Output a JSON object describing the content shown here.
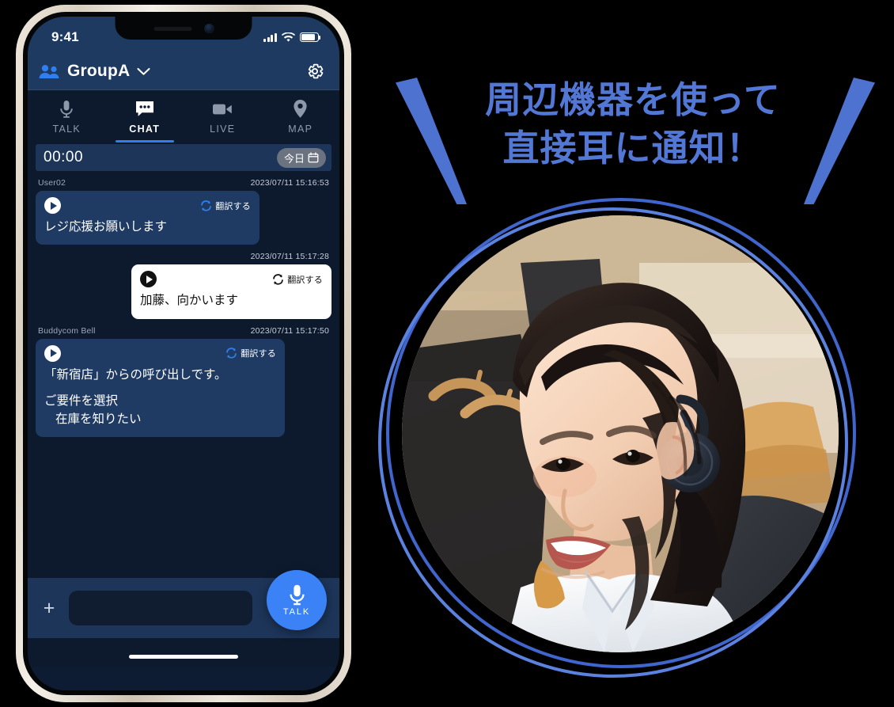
{
  "phone": {
    "status_bar": {
      "time": "9:41",
      "signal_icon": "signal-bars-icon",
      "wifi_icon": "wifi-icon",
      "battery_icon": "battery-icon"
    },
    "header": {
      "group_icon": "people-icon",
      "group_name": "GroupA",
      "chevron_icon": "chevron-down-icon",
      "settings_icon": "gear-icon"
    },
    "tabs": [
      {
        "label": "TALK",
        "icon": "microphone-icon",
        "active": false
      },
      {
        "label": "CHAT",
        "icon": "chat-bubble-icon",
        "active": true
      },
      {
        "label": "LIVE",
        "icon": "video-camera-icon",
        "active": false
      },
      {
        "label": "MAP",
        "icon": "map-pin-icon",
        "active": false
      }
    ],
    "timer_row": {
      "timer": "00:00",
      "today_label": "今日",
      "calendar_icon": "calendar-icon"
    },
    "messages": [
      {
        "sender": "User02",
        "timestamp": "2023/07/11 15:16:53",
        "direction": "incoming",
        "play_icon": "play-icon",
        "translate_icon": "translate-loop-icon",
        "translate_label": "翻訳する",
        "text": "レジ応援お願いします"
      },
      {
        "sender": "",
        "timestamp": "2023/07/11 15:17:28",
        "direction": "outgoing",
        "play_icon": "play-icon",
        "translate_icon": "translate-loop-icon",
        "translate_label": "翻訳する",
        "text": "加藤、向かいます"
      },
      {
        "sender": "Buddycom Bell",
        "timestamp": "2023/07/11 15:17:50",
        "direction": "incoming",
        "play_icon": "play-icon",
        "translate_icon": "translate-loop-icon",
        "translate_label": "翻訳する",
        "text_line1": "「新宿店」からの呼び出しです。",
        "text_line2": "ご要件を選択",
        "text_line3": "在庫を知りたい"
      }
    ],
    "composer": {
      "attach_icon": "plus-icon",
      "input_value": "",
      "input_placeholder": "",
      "talk_button_label": "TALK",
      "talk_button_icon": "microphone-icon"
    },
    "home_indicator": "home-indicator"
  },
  "promo": {
    "headline": "周辺機器を使って\n直接耳に通知！",
    "headline_color": "#5277d4",
    "wedge_color": "#4e72cf",
    "ring_color_outer": "#4066cd",
    "ring_color_inner": "#5c82e0",
    "photo_alt": "woman-with-bone-conduction-earpiece"
  },
  "colors": {
    "accent_blue": "#3b82f6",
    "header_navy": "#1e3a60",
    "app_background": "#0d1a2e",
    "bubble_incoming": "#1f3b63",
    "bubble_outgoing": "#ffffff",
    "promo_blue": "#4e72cf"
  }
}
